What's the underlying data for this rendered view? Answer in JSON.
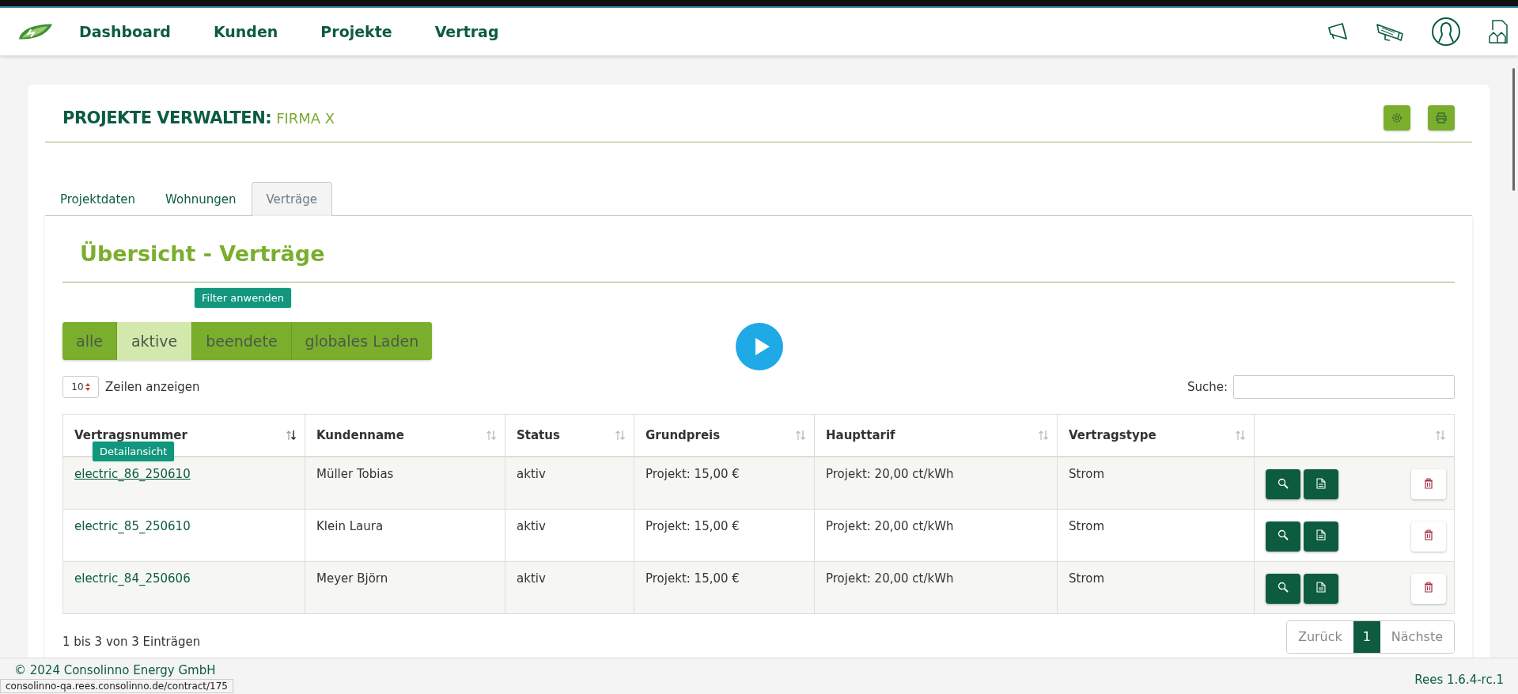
{
  "nav": {
    "items": [
      "Dashboard",
      "Kunden",
      "Projekte",
      "Vertrag"
    ]
  },
  "page": {
    "title": "PROJEKTE VERWALTEN:",
    "subtitle": "FIRMA X"
  },
  "tabs": [
    {
      "label": "Projektdaten",
      "selected": false
    },
    {
      "label": "Wohnungen",
      "selected": false
    },
    {
      "label": "Verträge",
      "selected": true
    }
  ],
  "section_title": "Übersicht - Verträge",
  "filter_tooltip": "Filter anwenden",
  "filters": [
    {
      "label": "alle",
      "selected": false
    },
    {
      "label": "aktive",
      "selected": true
    },
    {
      "label": "beendete",
      "selected": false
    },
    {
      "label": "globales Laden",
      "selected": false
    }
  ],
  "length": {
    "value": "10",
    "label": "Zeilen anzeigen"
  },
  "search": {
    "label": "Suche:"
  },
  "table": {
    "columns": [
      {
        "label": "Vertragsnummer",
        "sorted": true
      },
      {
        "label": "Kundenname",
        "sorted": false
      },
      {
        "label": "Status",
        "sorted": false
      },
      {
        "label": "Grundpreis",
        "sorted": false
      },
      {
        "label": "Haupttarif",
        "sorted": false
      },
      {
        "label": "Vertragstype",
        "sorted": false
      },
      {
        "sorted": false
      }
    ],
    "rows": [
      {
        "number": "electric_86_250610",
        "hovered": true,
        "customer": "Müller Tobias",
        "status": "aktiv",
        "base_price": "Projekt: 15,00 €",
        "tariff": "Projekt: 20,00 ct/kWh",
        "type": "Strom"
      },
      {
        "number": "electric_85_250610",
        "hovered": false,
        "customer": "Klein Laura",
        "status": "aktiv",
        "base_price": "Projekt: 15,00 €",
        "tariff": "Projekt: 20,00 ct/kWh",
        "type": "Strom"
      },
      {
        "number": "electric_84_250606",
        "hovered": false,
        "customer": "Meyer Björn",
        "status": "aktiv",
        "base_price": "Projekt: 15,00 €",
        "tariff": "Projekt: 20,00 ct/kWh",
        "type": "Strom"
      }
    ],
    "row_tooltip": "Detailansicht",
    "info": "1 bis 3 von 3 Einträgen"
  },
  "pagination": {
    "previous": "Zurück",
    "pages": [
      {
        "label": "1",
        "selected": true
      }
    ],
    "next": "Nächste"
  },
  "footer": {
    "copyright": "© 2024 Consolinno Energy GmbH",
    "version": "Rees 1.6.4-rc.1"
  },
  "status_url": "consolinno-qa.rees.consolinno.de/contract/175"
}
